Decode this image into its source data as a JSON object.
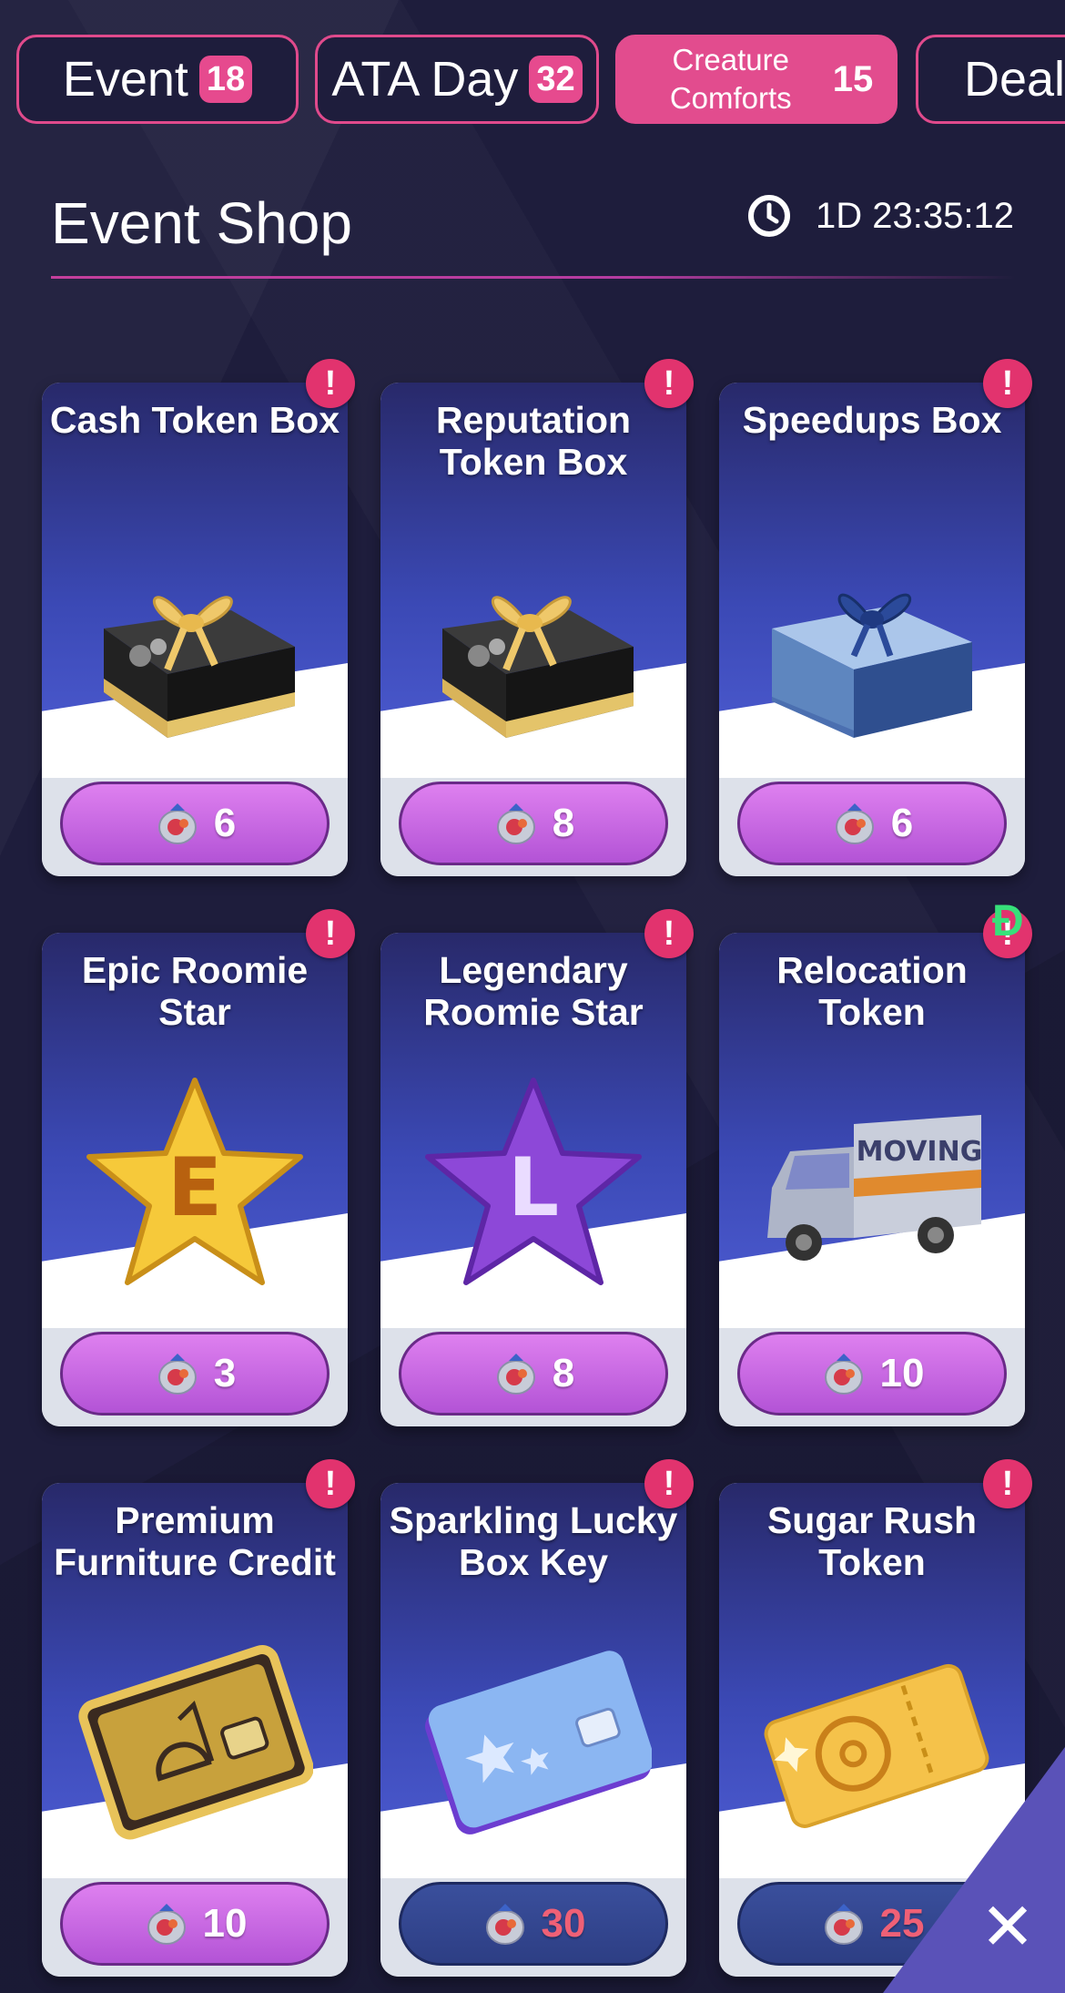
{
  "tabs": [
    {
      "label": "Event",
      "count": "18",
      "active": false
    },
    {
      "label": "ATA Day",
      "count": "32",
      "active": false
    },
    {
      "label": "Creature Comforts",
      "count": "15",
      "active": true
    },
    {
      "label": "Deal",
      "count": "",
      "active": false
    }
  ],
  "header": {
    "title": "Event Shop",
    "timer": "1D 23:35:12",
    "timer_icon": "clock-icon"
  },
  "items": [
    {
      "title": "Cash Token Box",
      "price": "6",
      "art": "gift-box-gold-icon",
      "alert": "!",
      "locked": false
    },
    {
      "title": "Reputation Token Box",
      "price": "8",
      "art": "gift-box-gold-icon",
      "alert": "!",
      "locked": false
    },
    {
      "title": "Speedups Box",
      "price": "6",
      "art": "gift-box-blue-icon",
      "alert": "!",
      "locked": false
    },
    {
      "title": "Epic Roomie Star",
      "price": "3",
      "art": "gold-star-icon",
      "art_letter": "E",
      "alert": "!",
      "locked": false
    },
    {
      "title": "Legendary Roomie Star",
      "price": "8",
      "art": "purple-star-icon",
      "art_letter": "L",
      "alert": "!",
      "locked": false
    },
    {
      "title": "Relocation Token",
      "price": "10",
      "art": "moving-truck-icon",
      "art_text": "MOVING",
      "alert": "!",
      "locked": false
    },
    {
      "title": "Premium Furniture Credit",
      "price": "10",
      "art": "gold-card-icon",
      "alert": "!",
      "locked": false
    },
    {
      "title": "Sparkling Lucky Box Key",
      "price": "30",
      "art": "blue-card-icon",
      "alert": "!",
      "locked": true
    },
    {
      "title": "Sugar Rush Token",
      "price": "25",
      "art": "donut-ticket-icon",
      "alert": "!",
      "locked": true
    }
  ],
  "currency_icon": "treat-bag-icon",
  "overlay_mark": "Đ",
  "close_label": "✕",
  "colors": {
    "accent_pink": "#e24c8e",
    "button_purple": "#c464e0",
    "locked_button": "#2d3e84",
    "locked_price": "#ef6076",
    "background": "#1e1d3c"
  }
}
